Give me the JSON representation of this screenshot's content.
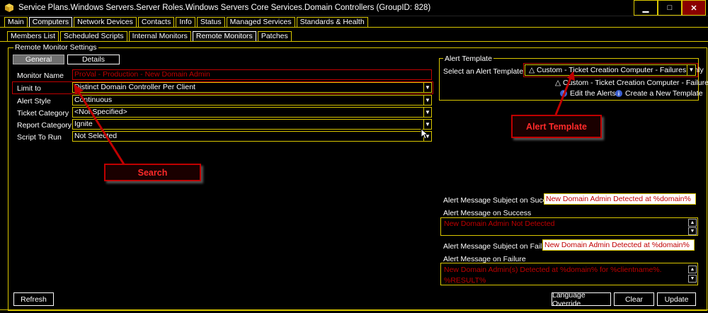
{
  "window": {
    "title": "Service Plans.Windows Servers.Server Roles.Windows Servers Core Services.Domain Controllers   (GroupID: 828)",
    "minimize": "▁",
    "maximize": "□",
    "close": "✕"
  },
  "main_tabs": [
    {
      "label": "Main",
      "active": false
    },
    {
      "label": "Computers",
      "active": true
    },
    {
      "label": "Network Devices",
      "active": false
    },
    {
      "label": "Contacts",
      "active": false
    },
    {
      "label": "Info",
      "active": false
    },
    {
      "label": "Status",
      "active": false
    },
    {
      "label": "Managed Services",
      "active": false
    },
    {
      "label": "Standards & Health",
      "active": false
    }
  ],
  "sub_tabs": [
    {
      "label": "Members List",
      "active": false
    },
    {
      "label": "Scheduled Scripts",
      "active": false
    },
    {
      "label": "Internal Monitors",
      "active": false
    },
    {
      "label": "Remote Monitors",
      "active": true
    },
    {
      "label": "Patches",
      "active": false
    }
  ],
  "settings": {
    "legend": "Remote Monitor Settings",
    "general_tab": "General",
    "details_tab": "Details",
    "fields": [
      {
        "label": "Monitor Name",
        "value": "ProVal - Production - New Domain Admin",
        "type": "text"
      },
      {
        "label": "Limit to",
        "value": "Distinct  Domain Controller Per Client",
        "type": "dropdown"
      },
      {
        "label": "Alert Style",
        "value": "Continuous",
        "type": "dropdown"
      },
      {
        "label": "Ticket Category",
        "value": "<Not Specified>",
        "type": "dropdown"
      },
      {
        "label": "Report Category",
        "value": "Ignite",
        "type": "dropdown"
      },
      {
        "label": "Script To Run",
        "value": "Not Selected",
        "type": "dropdown"
      }
    ]
  },
  "alert_template": {
    "legend": "Alert Template",
    "select_label": "Select an Alert Template",
    "selected": "△ Custom - Ticket Creation Computer - Failures Only",
    "option_preview": "△ Custom - Ticket Creation Computer - Failures Only",
    "edit_link": "Edit the Alerts",
    "create_link": "Create a New Template"
  },
  "messages": {
    "subject_success_label": "Alert Message Subject on Success:",
    "subject_success_value": "New Domain Admin Detected at %domain%",
    "success_label": "Alert Message on Success",
    "success_value": "New Domain Admin Not Detected",
    "subject_failure_label": "Alert Message Subject on Failure:",
    "subject_failure_value": "New Domain Admin Detected at %domain%",
    "failure_label": "Alert Message on Failure",
    "failure_line1": "New Domain Admin(s) Detected at %domain% for %clientname%.",
    "failure_line2": "%RESULT%"
  },
  "callouts": {
    "search": "Search",
    "alert_template": "Alert Template"
  },
  "buttons": {
    "refresh": "Refresh",
    "language_override": "Language Override",
    "clear": "Clear",
    "update": "Update"
  },
  "icons": {
    "app": "app-icon",
    "dropdown": "▼",
    "scroll_up": "▲",
    "scroll_down": "▼",
    "info": "i"
  },
  "colors": {
    "accent": "#d9c600",
    "callout_red": "#c00000",
    "background": "#000000"
  }
}
